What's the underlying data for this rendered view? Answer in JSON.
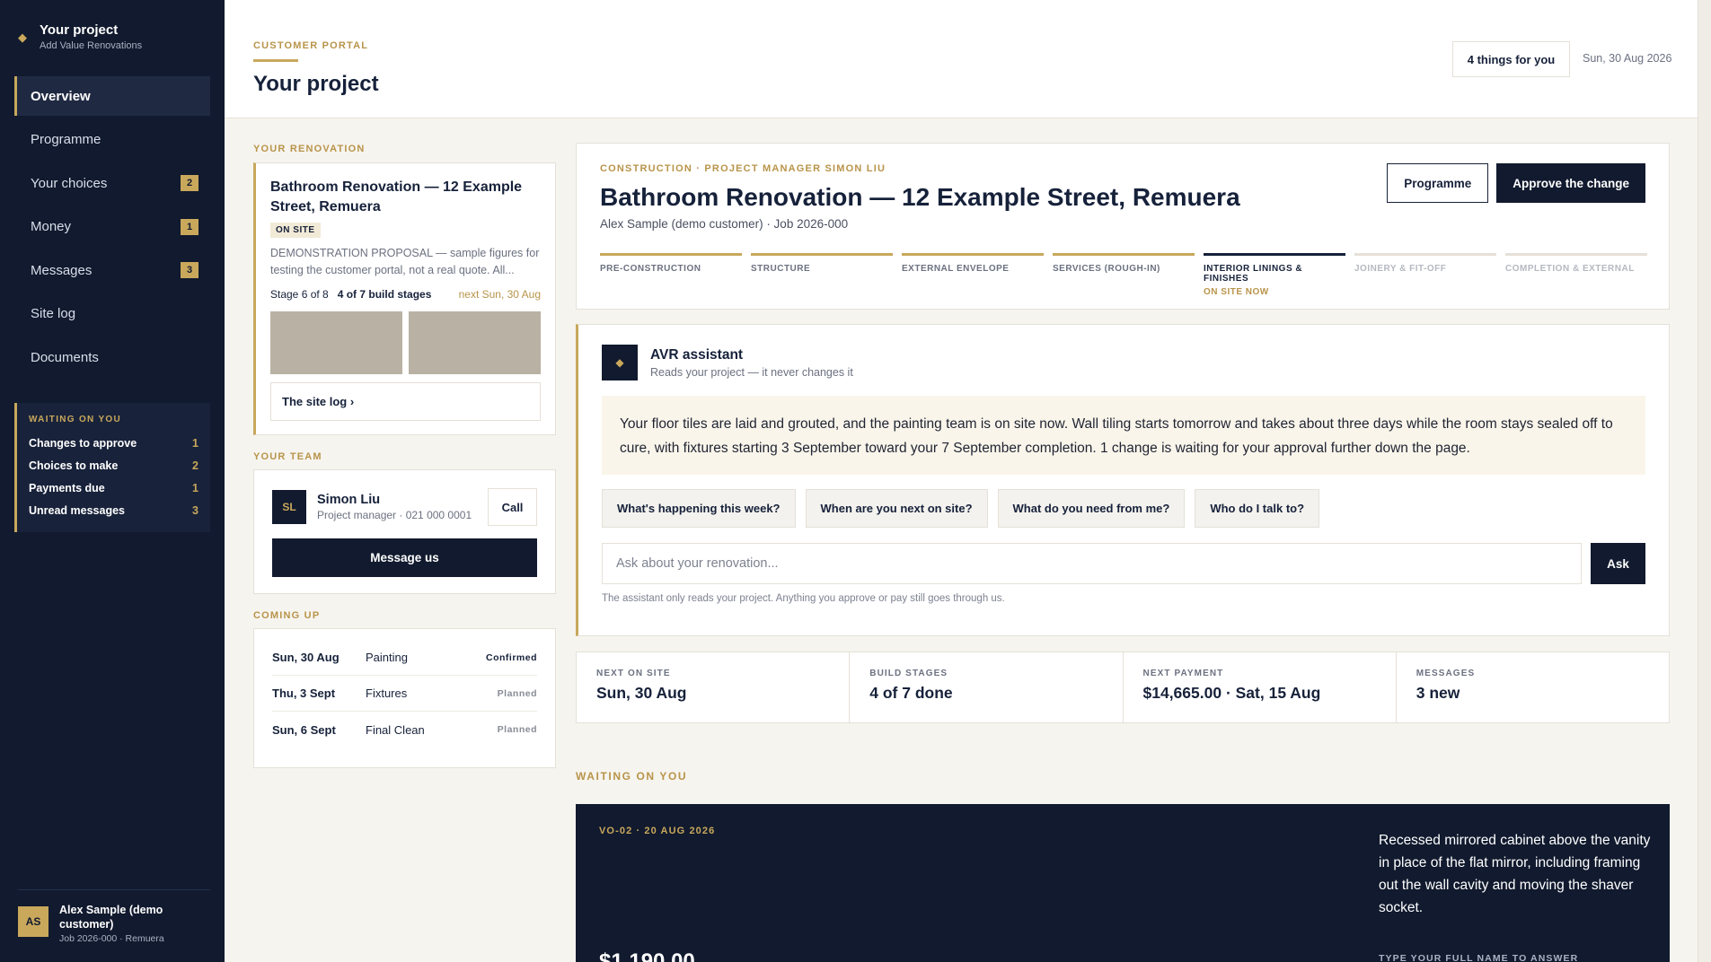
{
  "sidebar": {
    "brand_title": "Your project",
    "brand_subtitle": "Add Value Renovations",
    "nav": [
      {
        "label": "Overview",
        "badge": ""
      },
      {
        "label": "Programme",
        "badge": ""
      },
      {
        "label": "Your choices",
        "badge": "2"
      },
      {
        "label": "Money",
        "badge": "1"
      },
      {
        "label": "Messages",
        "badge": "3"
      },
      {
        "label": "Site log",
        "badge": ""
      },
      {
        "label": "Documents",
        "badge": ""
      }
    ],
    "waiting": {
      "heading": "WAITING ON YOU",
      "rows": [
        {
          "label": "Changes to approve",
          "count": "1"
        },
        {
          "label": "Choices to make",
          "count": "2"
        },
        {
          "label": "Payments due",
          "count": "1"
        },
        {
          "label": "Unread messages",
          "count": "3"
        }
      ]
    },
    "user": {
      "initials": "AS",
      "name": "Alex Sample (demo customer)",
      "meta": "Job 2026-000 · Remuera"
    }
  },
  "header": {
    "eyebrow": "CUSTOMER PORTAL",
    "title": "Your project",
    "things_button": "4 things for you",
    "date": "Sun, 30 Aug 2026"
  },
  "renovation": {
    "section_label": "YOUR RENOVATION",
    "title": "Bathroom Renovation — 12 Example Street, Remuera",
    "status": "ON SITE",
    "description": "DEMONSTRATION PROPOSAL — sample figures for testing the customer portal, not a real quote. All...",
    "stage": "Stage 6 of 8",
    "builds": "4 of 7 build stages",
    "next": "next Sun, 30 Aug",
    "site_log_link": "The site log ›"
  },
  "team": {
    "section_label": "YOUR TEAM",
    "initials": "SL",
    "name": "Simon Liu",
    "role": "Project manager · 021 000 0001",
    "call_label": "Call",
    "message_label": "Message us"
  },
  "coming_up": {
    "section_label": "COMING UP",
    "items": [
      {
        "date": "Sun, 30 Aug",
        "what": "Painting",
        "status": "Confirmed"
      },
      {
        "date": "Thu, 3 Sept",
        "what": "Fixtures",
        "status": "Planned"
      },
      {
        "date": "Sun, 6 Sept",
        "what": "Final Clean",
        "status": "Planned"
      }
    ]
  },
  "project": {
    "eyebrow": "CONSTRUCTION · PROJECT MANAGER SIMON LIU",
    "title": "Bathroom Renovation — 12 Example Street, Remuera",
    "subtitle": "Alex Sample (demo customer) · Job 2026-000",
    "programme_button": "Programme",
    "approve_button": "Approve the change",
    "stages": [
      {
        "label": "PRE-CONSTRUCTION",
        "state": "done"
      },
      {
        "label": "STRUCTURE",
        "state": "done"
      },
      {
        "label": "EXTERNAL ENVELOPE",
        "state": "done"
      },
      {
        "label": "SERVICES (ROUGH-IN)",
        "state": "done"
      },
      {
        "label": "INTERIOR LININGS & FINISHES",
        "state": "current",
        "note": "ON SITE NOW"
      },
      {
        "label": "JOINERY & FIT-OFF",
        "state": "future"
      },
      {
        "label": "COMPLETION & EXTERNAL",
        "state": "future"
      }
    ]
  },
  "assistant": {
    "name": "AVR assistant",
    "tagline": "Reads your project — it never changes it",
    "message": "Your floor tiles are laid and grouted, and the painting team is on site now. Wall tiling starts tomorrow and takes about three days while the room stays sealed off to cure, with fixtures starting 3 September toward your 7 September completion. 1 change is waiting for your approval further down the page.",
    "chips": [
      "What's happening this week?",
      "When are you next on site?",
      "What do you need from me?",
      "Who do I talk to?"
    ],
    "placeholder": "Ask about your renovation...",
    "ask_label": "Ask",
    "note": "The assistant only reads your project. Anything you approve or pay still goes through us."
  },
  "stats": [
    {
      "label": "NEXT ON SITE",
      "value": "Sun, 30 Aug"
    },
    {
      "label": "BUILD STAGES",
      "value": "4 of 7 done"
    },
    {
      "label": "NEXT PAYMENT",
      "value": "$14,665.00 · Sat, 15 Aug"
    },
    {
      "label": "MESSAGES",
      "value": "3 new"
    }
  ],
  "waiting_section": {
    "label": "WAITING ON YOU",
    "ref": "VO-02 · 20 AUG 2026",
    "description": "Recessed mirrored cabinet above the vanity in place of the flat mirror, including framing out the wall cavity and moving the shaver socket.",
    "amount": "$1,190.00",
    "prompt": "TYPE YOUR FULL NAME TO ANSWER"
  }
}
